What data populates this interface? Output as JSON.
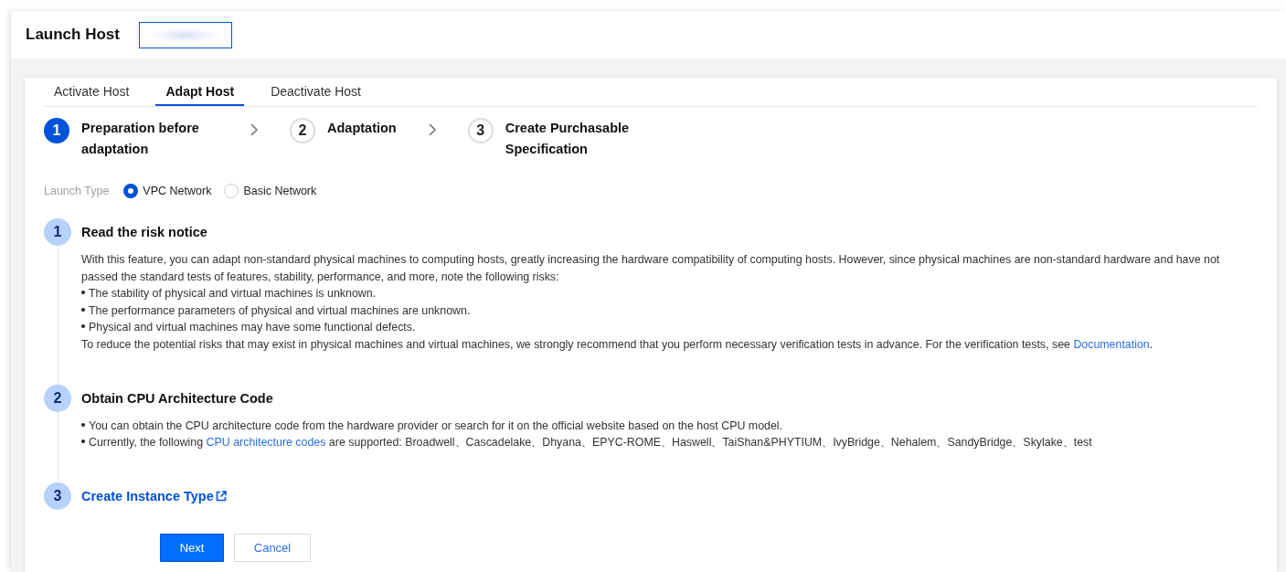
{
  "header": {
    "title": "Launch Host"
  },
  "tabs": [
    {
      "label": "Activate Host",
      "selected": false
    },
    {
      "label": "Adapt Host",
      "selected": true
    },
    {
      "label": "Deactivate Host",
      "selected": false
    }
  ],
  "steps": [
    {
      "number": "1",
      "title": "Preparation before adaptation",
      "selected": true
    },
    {
      "number": "2",
      "title": "Adaptation",
      "selected": false
    },
    {
      "number": "3",
      "title": "Create Purchasable Specification",
      "selected": false
    }
  ],
  "launch_type": {
    "label": "Launch Type",
    "options": [
      {
        "label": "VPC Network",
        "selected": true
      },
      {
        "label": "Basic Network",
        "selected": false
      }
    ]
  },
  "sections": [
    {
      "number": "1",
      "kind": "heading",
      "title": "Read the risk notice",
      "blocks": [
        {
          "kind": "paragraph",
          "parts": [
            {
              "kind": "text",
              "text": "With this feature, you can adapt non-standard physical machines to computing hosts, greatly increasing the hardware compatibility of computing hosts. However, since physical machines are non-standard hardware and have not passed the standard tests of features, stability, performance, and more, note the following risks:"
            }
          ]
        },
        {
          "kind": "bullet",
          "parts": [
            {
              "kind": "text",
              "text": "The stability of physical and virtual machines is unknown."
            }
          ]
        },
        {
          "kind": "bullet",
          "parts": [
            {
              "kind": "text",
              "text": "The performance parameters of physical and virtual machines are unknown."
            }
          ]
        },
        {
          "kind": "bullet",
          "parts": [
            {
              "kind": "text",
              "text": "Physical and virtual machines may have some functional defects."
            }
          ]
        },
        {
          "kind": "paragraph",
          "parts": [
            {
              "kind": "text",
              "text": "To reduce the potential risks that may exist in physical machines and virtual machines, we strongly recommend that you perform necessary verification tests in advance. For the verification tests, see "
            },
            {
              "kind": "link",
              "text": "Documentation"
            },
            {
              "kind": "text",
              "text": "."
            }
          ]
        }
      ]
    },
    {
      "number": "2",
      "kind": "heading",
      "title": "Obtain CPU Architecture Code",
      "blocks": [
        {
          "kind": "bullet",
          "parts": [
            {
              "kind": "text",
              "text": "You can obtain the CPU architecture code from the hardware provider or search for it on the official website based on the host CPU model."
            }
          ]
        },
        {
          "kind": "bullet",
          "parts": [
            {
              "kind": "text",
              "text": "Currently, the following "
            },
            {
              "kind": "link",
              "text": "CPU architecture codes"
            },
            {
              "kind": "text",
              "text": " are supported: Broadwell、Cascadelake、Dhyana、EPYC-ROME、Haswell、TaiShan&PHYTIUM、IvyBridge、Nehalem、SandyBridge、Skylake、test"
            }
          ]
        }
      ]
    },
    {
      "number": "3",
      "kind": "link",
      "title": "Create Instance Type"
    }
  ],
  "buttons": [
    {
      "label": "Next",
      "kind": "primary"
    },
    {
      "label": "Cancel",
      "kind": "secondary"
    }
  ]
}
